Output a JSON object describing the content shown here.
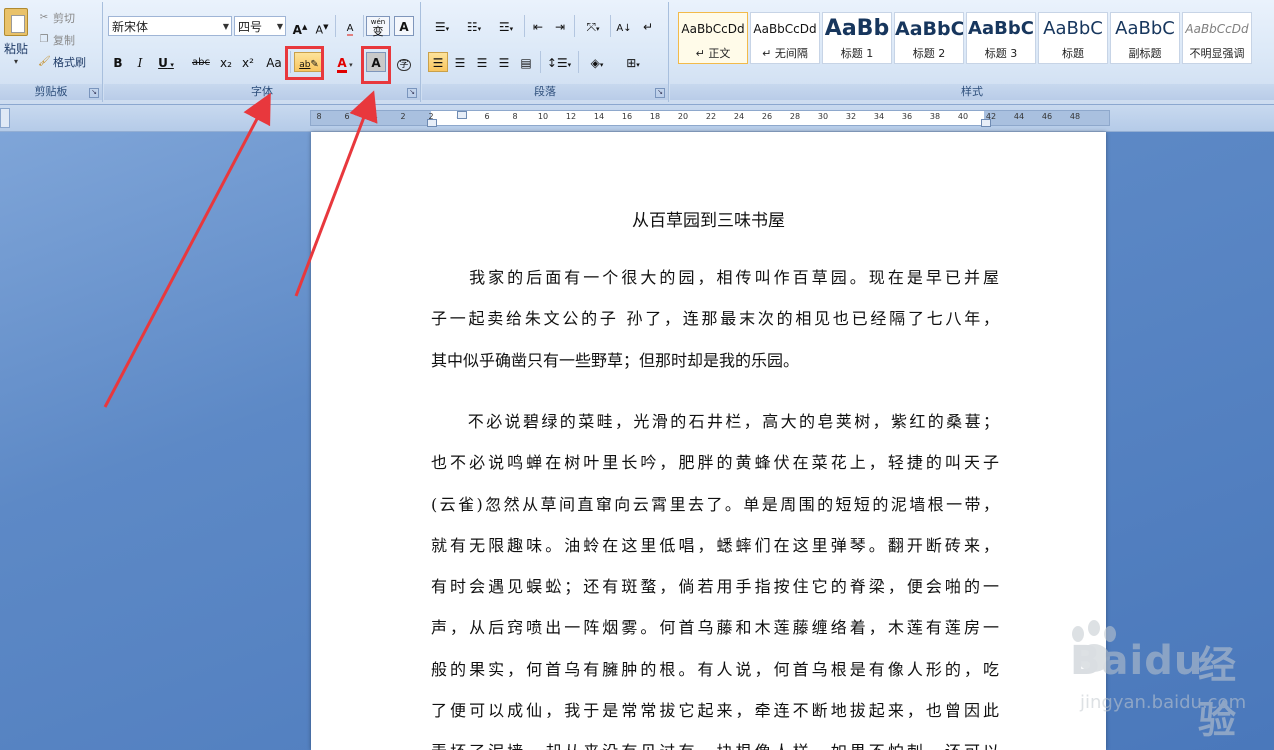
{
  "clipboard": {
    "paste_label": "粘贴",
    "cut_label": "剪切",
    "copy_label": "复制",
    "format_painter_label": "格式刷",
    "group_label": "剪贴板"
  },
  "font": {
    "font_name": "新宋体",
    "font_size": "四号",
    "grow_glyph": "A",
    "shrink_glyph": "A",
    "clear_glyph": "A",
    "phonetic_glyph": "wén",
    "phonetic_char": "变",
    "border_glyph": "A",
    "bold_glyph": "B",
    "italic_glyph": "I",
    "underline_glyph": "U",
    "strike_glyph": "abc",
    "subscript_glyph": "x₂",
    "superscript_glyph": "x²",
    "case_glyph": "Aa",
    "highlight_glyph": "ab",
    "color_glyph": "A",
    "shading_glyph": "A",
    "enclose_glyph": "字",
    "group_label": "字体"
  },
  "paragraph": {
    "group_label": "段落"
  },
  "styles": {
    "group_label": "样式",
    "items": [
      {
        "sample": "AaBbCcDd",
        "name": "↵ 正文"
      },
      {
        "sample": "AaBbCcDd",
        "name": "↵ 无间隔"
      },
      {
        "sample": "AaBb",
        "name": "标题 1"
      },
      {
        "sample": "AaBbC",
        "name": "标题 2"
      },
      {
        "sample": "AaBbC",
        "name": "标题 3"
      },
      {
        "sample": "AaBbC",
        "name": "标题"
      },
      {
        "sample": "AaBbC",
        "name": "副标题"
      },
      {
        "sample": "AaBbCcDd",
        "name": "不明显强调"
      }
    ]
  },
  "ruler": {
    "numbers": [
      "8",
      "6",
      "4",
      "2",
      "2",
      "4",
      "6",
      "8",
      "10",
      "12",
      "14",
      "16",
      "18",
      "20",
      "22",
      "24",
      "26",
      "28",
      "30",
      "32",
      "34",
      "36",
      "38",
      "40",
      "42",
      "44",
      "46",
      "48"
    ]
  },
  "document": {
    "title": "从百草园到三味书屋",
    "para1": [
      "　　我家的后面有一个很大的园，相传叫作百草园。现在是早已并屋",
      "子一起卖给朱文公的子 孙了，连那最末次的相见也已经隔了七八年，",
      "其中似乎确凿只有一些野草；但那时却是我的乐园。"
    ],
    "para2": [
      "　　不必说碧绿的菜畦，光滑的石井栏，高大的皂荚树，紫红的桑葚；",
      "也不必说鸣蝉在树叶里长吟，肥胖的黄蜂伏在菜花上，轻捷的叫天子",
      "(云雀)忽然从草间直窜向云霄里去了。单是周围的短短的泥墙根一带，",
      "就有无限趣味。油蛉在这里低唱，蟋蟀们在这里弹琴。翻开断砖来，",
      "有时会遇见蜈蚣；还有斑蝥，倘若用手指按住它的脊梁，便会啪的一",
      "声，从后窍喷出一阵烟雾。何首乌藤和木莲藤缠络着，木莲有莲房一",
      "般的果实，何首乌有臃肿的根。有人说，何首乌根是有像人形的，吃",
      "了便可以成仙，我于是常常拔它起来，牵连不断地拔起来，也曾因此",
      "弄坏了泥墙，却从来没有见过有一块根像人样。如果不怕刺，还可以"
    ]
  },
  "watermark": {
    "brand": "Bai",
    "brand2": "du",
    "cn": "经验",
    "url": "jingyan.baidu.com"
  },
  "colors": {
    "annotation_red": "#e8383d",
    "font_color_red": "#e00000"
  }
}
